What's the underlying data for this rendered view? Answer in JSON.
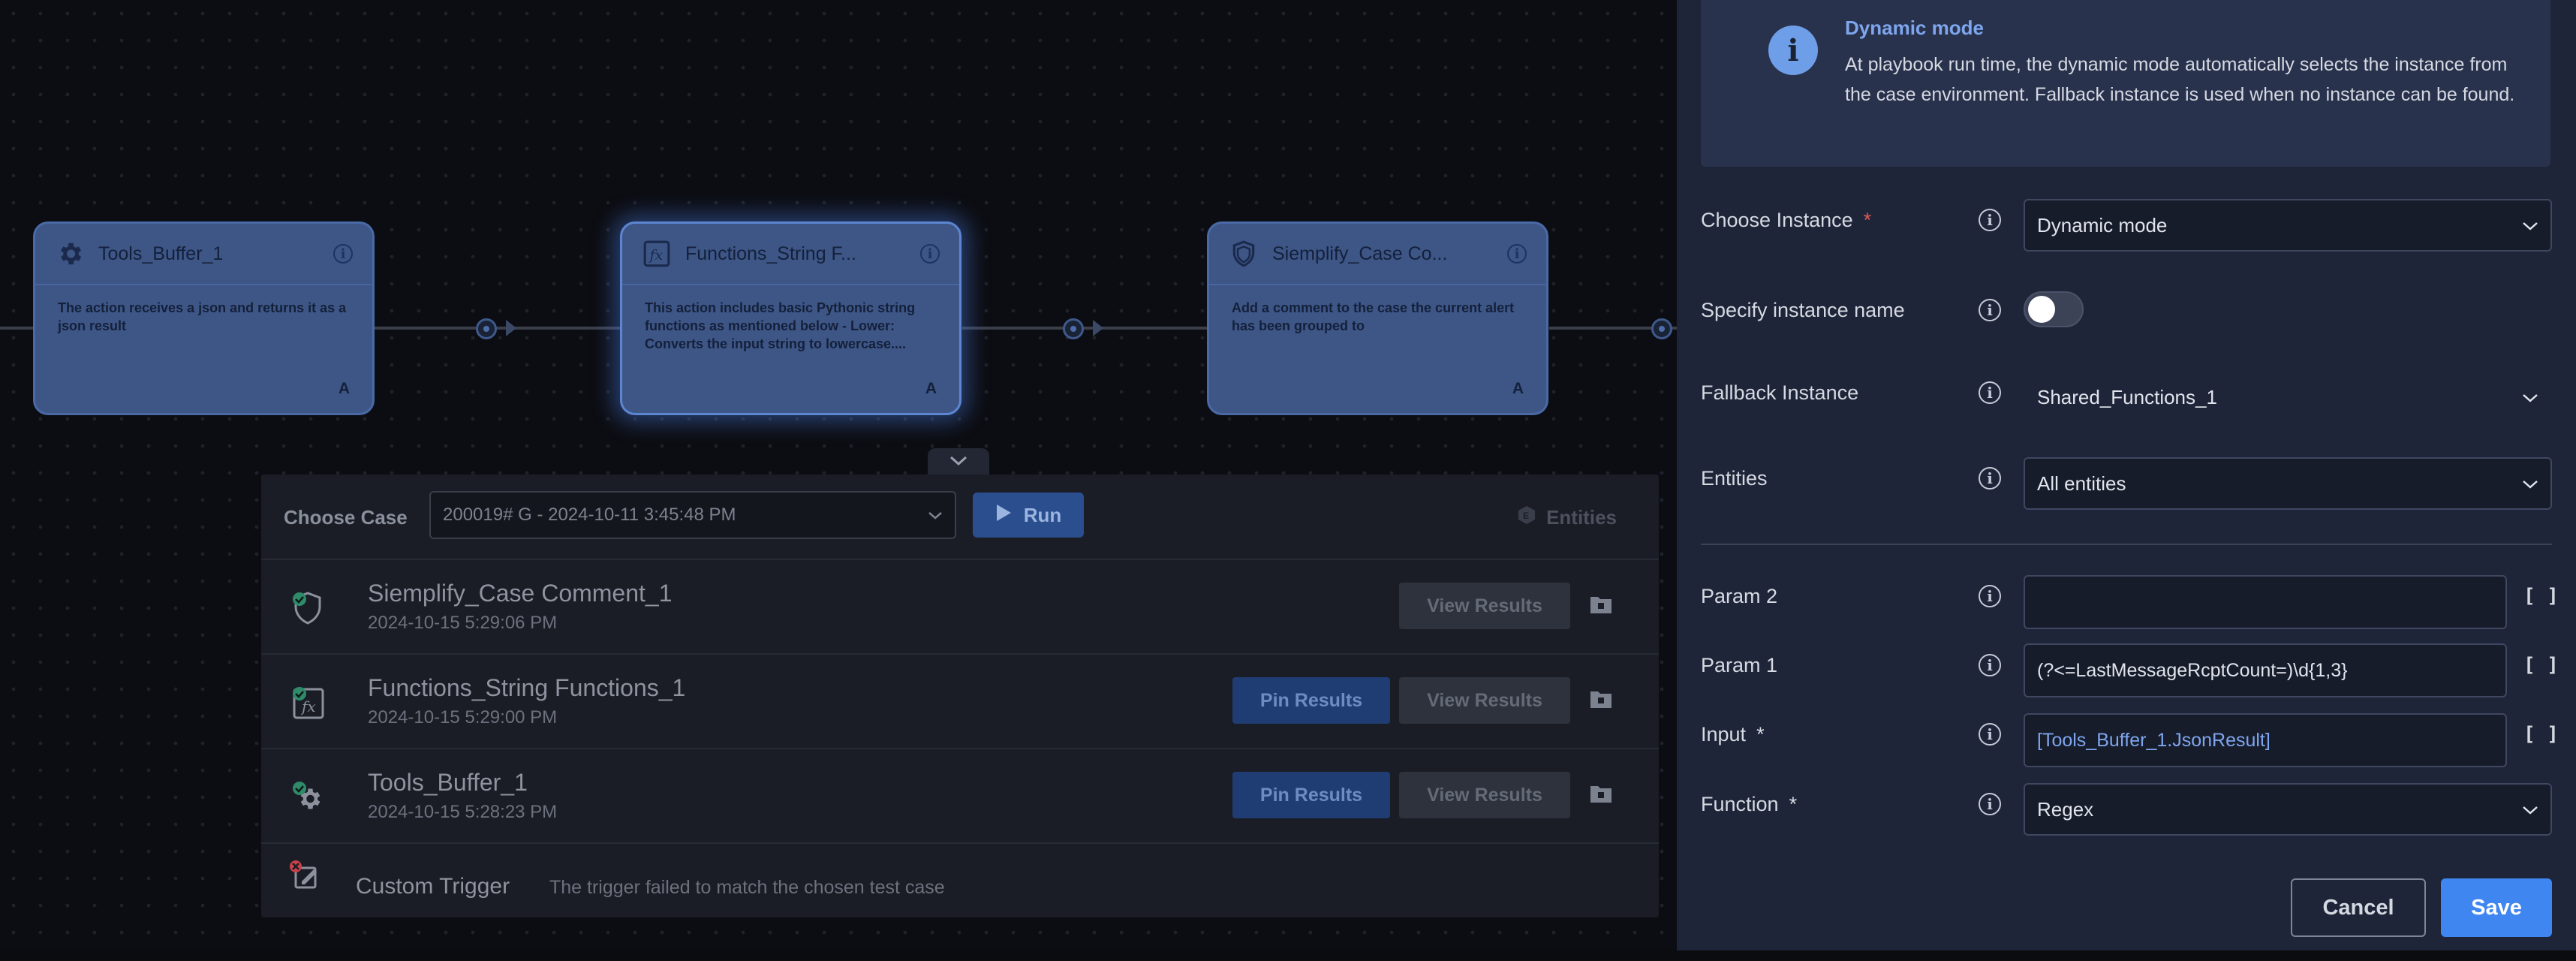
{
  "canvas": {
    "nodes": [
      {
        "title": "Tools_Buffer_1",
        "icon": "gear-icon",
        "description": "The action receives a json and returns it as a json result",
        "badge": "A"
      },
      {
        "title": "Functions_String F...",
        "icon": "function-icon",
        "description": "This action includes basic Pythonic string functions as mentioned below - Lower: Converts the input string to lowercase....",
        "badge": "A"
      },
      {
        "title": "Siemplify_Case Co...",
        "icon": "shield-icon",
        "description": "Add a comment to the case the current alert has been grouped to",
        "badge": "A"
      }
    ]
  },
  "test_panel": {
    "choose_case_label": "Choose Case",
    "case_value": "200019# G - 2024-10-11 3:45:48 PM",
    "run_label": "Run",
    "entities_label": "Entities",
    "rows": [
      {
        "name": "Siemplify_Case Comment_1",
        "time": "2024-10-15 5:29:06 PM",
        "view_label": "View Results"
      },
      {
        "name": "Functions_String Functions_1",
        "time": "2024-10-15 5:29:00 PM",
        "pin_label": "Pin Results",
        "view_label": "View Results"
      },
      {
        "name": "Tools_Buffer_1",
        "time": "2024-10-15 5:28:23 PM",
        "pin_label": "Pin Results",
        "view_label": "View Results"
      }
    ],
    "trigger": {
      "name": "Custom Trigger",
      "message": "The trigger failed to match the chosen test case"
    }
  },
  "side_panel": {
    "banner": {
      "title": "Dynamic mode",
      "text": "At playbook run time, the dynamic mode automatically selects the instance from the case environment. Fallback instance is used when no instance can be found."
    },
    "fields": {
      "choose_instance": {
        "label": "Choose Instance",
        "required": "*",
        "value": "Dynamic mode"
      },
      "specify_instance_name": {
        "label": "Specify instance name",
        "enabled": false
      },
      "fallback_instance": {
        "label": "Fallback Instance",
        "value": "Shared_Functions_1"
      },
      "entities": {
        "label": "Entities",
        "value": "All entities"
      },
      "param2": {
        "label": "Param 2",
        "value": ""
      },
      "param1": {
        "label": "Param 1",
        "value": "(?<=LastMessageRcptCount=)\\d{1,3}"
      },
      "input": {
        "label": "Input",
        "required": "*",
        "value": "[Tools_Buffer_1.JsonResult]"
      },
      "function": {
        "label": "Function",
        "required": "*",
        "value": "Regex"
      }
    },
    "bracket_symbol": "[ ]",
    "cancel_label": "Cancel",
    "save_label": "Save"
  }
}
